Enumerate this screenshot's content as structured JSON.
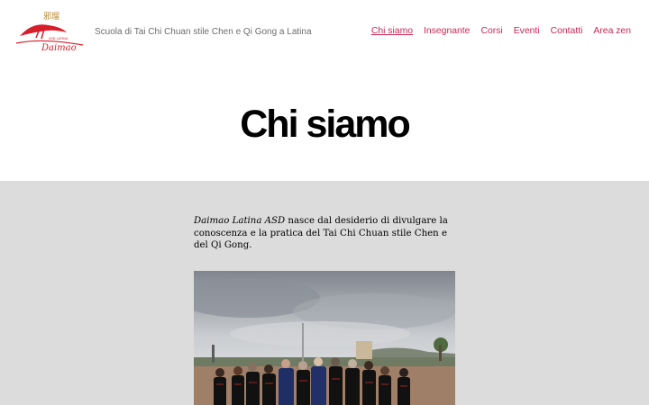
{
  "site": {
    "logo_chinese": "邪瑠",
    "logo_small": "ASD LATINA",
    "logo_script": "Daimao",
    "tagline": "Scuola di Tai Chi Chuan stile Chen e Qi Gong a Latina"
  },
  "nav": {
    "items": [
      {
        "label": "Chi siamo",
        "current": true
      },
      {
        "label": "Insegnante",
        "current": false
      },
      {
        "label": "Corsi",
        "current": false
      },
      {
        "label": "Eventi",
        "current": false
      },
      {
        "label": "Contatti",
        "current": false
      },
      {
        "label": "Area zen",
        "current": false
      }
    ]
  },
  "page": {
    "title": "Chi siamo"
  },
  "intro": {
    "org_name": "Daimao Latina ASD",
    "text": " nasce dal desiderio di divulgare la conoscenza e la pratica del Tai Chi Chuan stile Chen e del Qi Gong."
  },
  "colors": {
    "accent": "#cd2653",
    "content_bg": "#dcdcdc",
    "logo_red": "#d81e2a"
  },
  "photo": {
    "icon": "group-photo"
  }
}
